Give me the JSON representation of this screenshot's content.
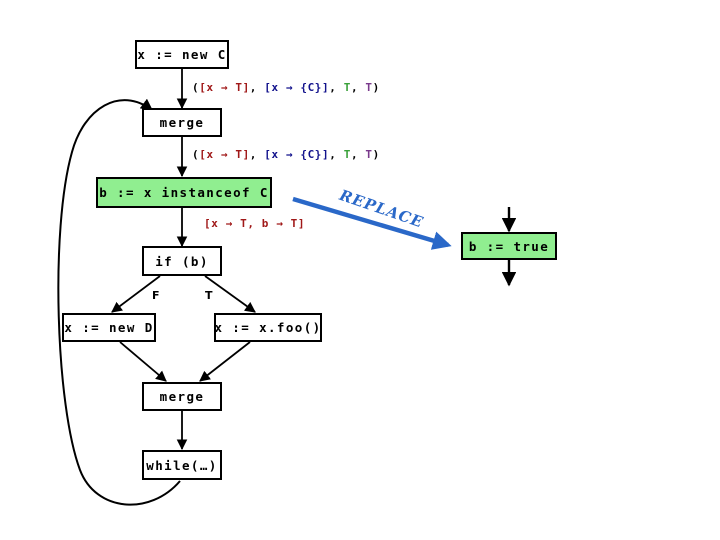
{
  "diagram": {
    "title": "control-flow-graph-replace-transformation",
    "colors": {
      "box_fill_plain": "#ffffff",
      "box_fill_highlight": "#90ee90",
      "box_border": "#000000",
      "edge": "#000000",
      "replace_arrow": "#2a68c8",
      "annot_red": "#a01818",
      "annot_navy": "#12128c",
      "annot_green": "#3aa13a",
      "annot_purple": "#7a3a8c"
    },
    "nodes": [
      {
        "id": "new_c",
        "label": "x := new C",
        "fill": "plain"
      },
      {
        "id": "merge_top",
        "label": "merge",
        "fill": "plain"
      },
      {
        "id": "instanceof",
        "label": "b := x instanceof C",
        "fill": "highlight"
      },
      {
        "id": "if_b",
        "label": "if (b)",
        "fill": "plain"
      },
      {
        "id": "new_d",
        "label": "x := new D",
        "fill": "plain"
      },
      {
        "id": "foo",
        "label": "x := x.foo()",
        "fill": "plain"
      },
      {
        "id": "merge_bot",
        "label": "merge",
        "fill": "plain"
      },
      {
        "id": "while",
        "label": "while(…)",
        "fill": "plain"
      },
      {
        "id": "b_true",
        "label": "b := true",
        "fill": "highlight"
      }
    ],
    "branch_labels": {
      "false": "F",
      "true": "T"
    },
    "replace_arrow_label": "REPLACE",
    "annotations": [
      {
        "id": "annot_after_new_c",
        "parts": [
          {
            "text": "(",
            "color": "black"
          },
          {
            "text": "[x → T]",
            "color": "red"
          },
          {
            "text": ", ",
            "color": "black"
          },
          {
            "text": "[x → {C}]",
            "color": "navy"
          },
          {
            "text": ", ",
            "color": "black"
          },
          {
            "text": "T",
            "color": "green"
          },
          {
            "text": ", ",
            "color": "black"
          },
          {
            "text": "T",
            "color": "purple"
          },
          {
            "text": ")",
            "color": "black"
          }
        ]
      },
      {
        "id": "annot_after_merge",
        "parts": [
          {
            "text": "(",
            "color": "black"
          },
          {
            "text": "[x → T]",
            "color": "red"
          },
          {
            "text": ", ",
            "color": "black"
          },
          {
            "text": "[x → {C}]",
            "color": "navy"
          },
          {
            "text": ", ",
            "color": "black"
          },
          {
            "text": "T",
            "color": "green"
          },
          {
            "text": ", ",
            "color": "black"
          },
          {
            "text": "T",
            "color": "purple"
          },
          {
            "text": ")",
            "color": "black"
          }
        ]
      },
      {
        "id": "annot_after_instanceof",
        "parts": [
          {
            "text": "[x → T,  b → T]",
            "color": "red"
          }
        ]
      }
    ]
  }
}
